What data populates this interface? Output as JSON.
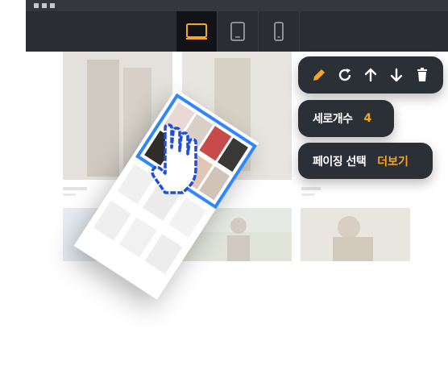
{
  "device_toggle": {
    "items": [
      {
        "name": "desktop",
        "active": true
      },
      {
        "name": "tablet",
        "active": false
      },
      {
        "name": "mobile",
        "active": false
      }
    ]
  },
  "toolbar": {
    "icons": [
      "pencil-icon",
      "refresh-icon",
      "arrow-up-icon",
      "arrow-down-icon",
      "trash-icon"
    ]
  },
  "rows_setting": {
    "label": "세로개수",
    "value": "4"
  },
  "paging_setting": {
    "label": "페이징 선택",
    "value": "더보기"
  },
  "colors": {
    "accent": "#f5a623",
    "panel": "#2b2f36",
    "topbar": "#2a2d32",
    "frame": "#2f86ff"
  }
}
